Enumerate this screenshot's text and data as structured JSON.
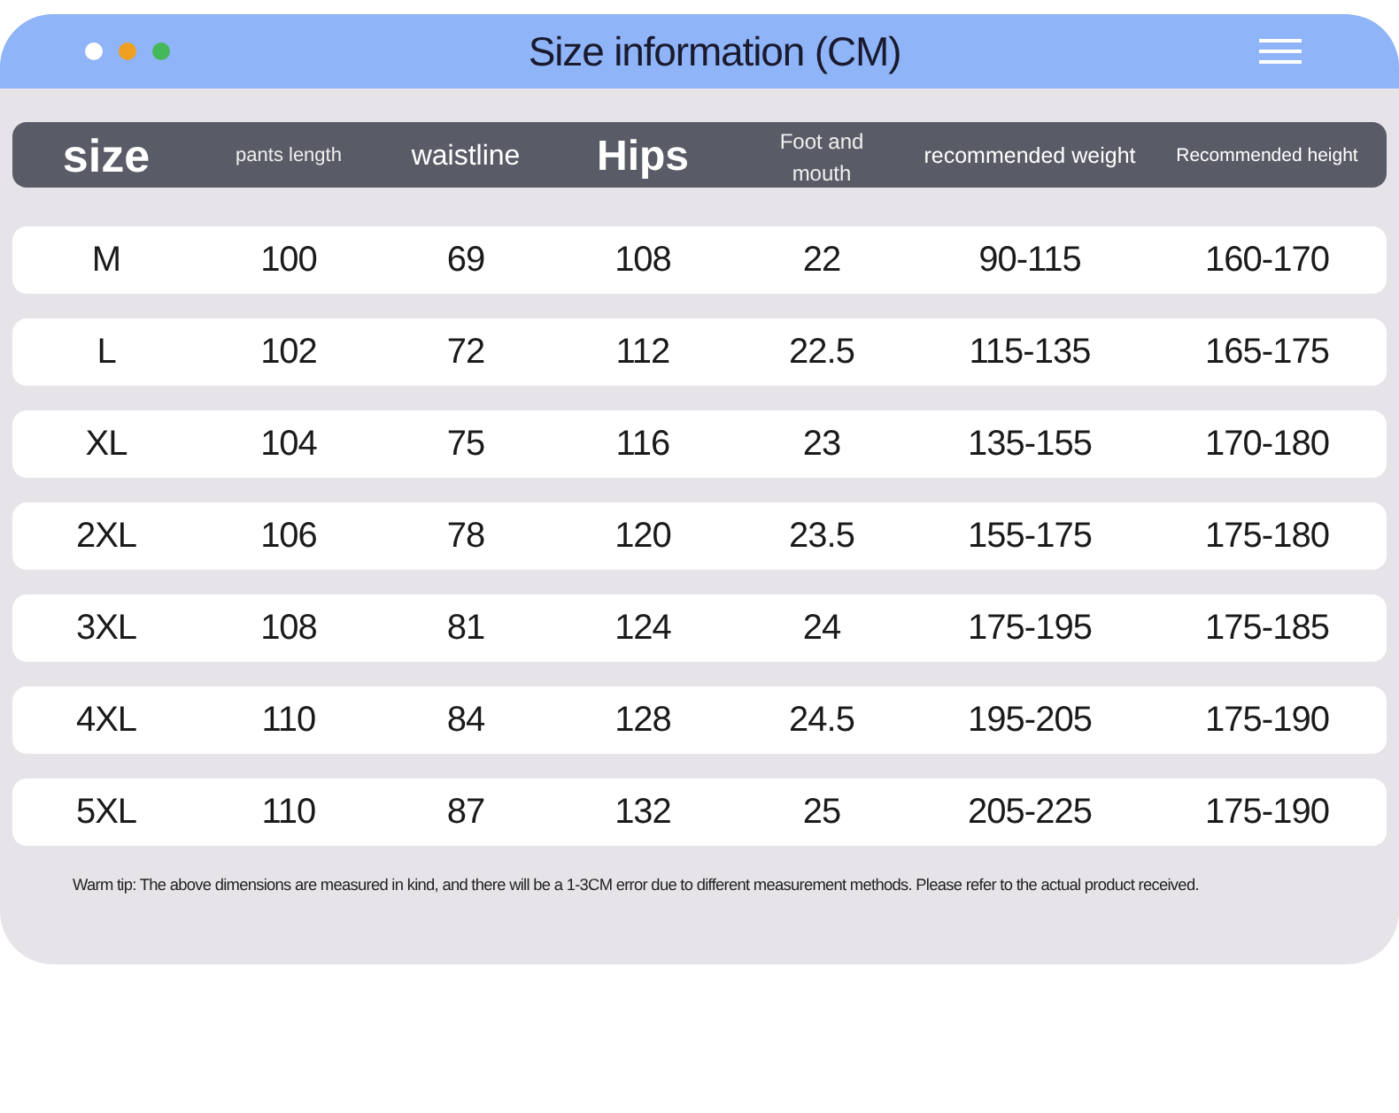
{
  "window": {
    "title": "Size information (CM)"
  },
  "table": {
    "columns": [
      "size",
      "pants length",
      "waistline",
      "Hips",
      "Foot and mouth",
      "recommended weight",
      "Recommended height"
    ],
    "rows": [
      [
        "M",
        "100",
        "69",
        "108",
        "22",
        "90-115",
        "160-170"
      ],
      [
        "L",
        "102",
        "72",
        "112",
        "22.5",
        "115-135",
        "165-175"
      ],
      [
        "XL",
        "104",
        "75",
        "116",
        "23",
        "135-155",
        "170-180"
      ],
      [
        "2XL",
        "106",
        "78",
        "120",
        "23.5",
        "155-175",
        "175-180"
      ],
      [
        "3XL",
        "108",
        "81",
        "124",
        "24",
        "175-195",
        "175-185"
      ],
      [
        "4XL",
        "110",
        "84",
        "128",
        "24.5",
        "195-205",
        "175-190"
      ],
      [
        "5XL",
        "110",
        "87",
        "132",
        "25",
        "205-225",
        "175-190"
      ]
    ]
  },
  "footnote": "Warm tip: The above dimensions are measured in kind, and there will be a 1-3CM error due to different measurement methods. Please refer to the actual product received."
}
